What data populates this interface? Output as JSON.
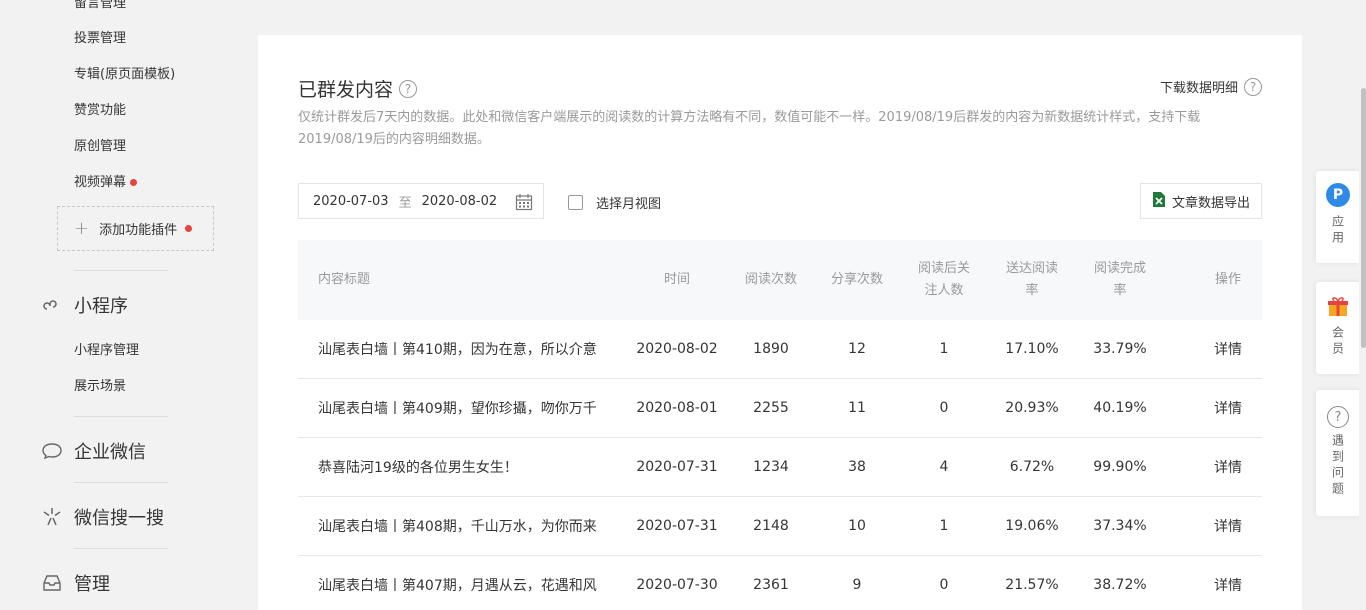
{
  "sidebar": {
    "cut_item": "留言管理",
    "sub_items_top": [
      "投票管理",
      "专辑(原页面模板)",
      "赞赏功能",
      "原创管理",
      "视频弹幕"
    ],
    "add_plugin": "添加功能插件",
    "sections": {
      "miniprogram": "小程序",
      "miniprogram_items": [
        "小程序管理",
        "展示场景"
      ],
      "wework": "企业微信",
      "search": "微信搜一搜",
      "manage": "管理"
    }
  },
  "main": {
    "title": "已群发内容",
    "download": "下载数据明细",
    "description": "仅统计群发后7天内的数据。此处和微信客户端展示的阅读数的计算方法略有不同，数值可能不一样。2019/08/19后群发的内容为新数据统计样式，支持下载2019/08/19后的内容明细数据。",
    "date_start": "2020-07-03",
    "date_sep": "至",
    "date_end": "2020-08-02",
    "month_view": "选择月视图",
    "export": "文章数据导出"
  },
  "table": {
    "headers": {
      "title": "内容标题",
      "time": "时间",
      "reads": "阅读次数",
      "shares": "分享次数",
      "follows": "阅读后关注人数",
      "deliver_rate": "送达阅读率",
      "complete_rate": "阅读完成率",
      "op": "操作"
    },
    "rows": [
      {
        "title": "汕尾表白墙丨第410期，因为在意，所以介意",
        "time": "2020-08-02",
        "reads": "1890",
        "shares": "12",
        "follows": "1",
        "deliver": "17.10%",
        "complete": "33.79%",
        "op": "详情"
      },
      {
        "title": "汕尾表白墙丨第409期，望你珍攝，吻你万千",
        "time": "2020-08-01",
        "reads": "2255",
        "shares": "11",
        "follows": "0",
        "deliver": "20.93%",
        "complete": "40.19%",
        "op": "详情"
      },
      {
        "title": "恭喜陆河19级的各位男生女生！",
        "time": "2020-07-31",
        "reads": "1234",
        "shares": "38",
        "follows": "4",
        "deliver": "6.72%",
        "complete": "99.90%",
        "op": "详情"
      },
      {
        "title": "汕尾表白墙丨第408期，千山万水，为你而来",
        "time": "2020-07-31",
        "reads": "2148",
        "shares": "10",
        "follows": "1",
        "deliver": "19.06%",
        "complete": "37.34%",
        "op": "详情"
      },
      {
        "title": "汕尾表白墙丨第407期，月遇从云，花遇和风",
        "time": "2020-07-30",
        "reads": "2361",
        "shares": "9",
        "follows": "0",
        "deliver": "21.57%",
        "complete": "38.72%",
        "op": "详情"
      }
    ]
  },
  "float_panel": {
    "apps": "应用",
    "apps_badge": "P",
    "member": "会员",
    "problem": "遇到问题",
    "help_glyph": "?"
  },
  "colors": {
    "accent": "#1aad19",
    "badge_blue": "#2e8ae6",
    "red_dot": "#e64340"
  }
}
